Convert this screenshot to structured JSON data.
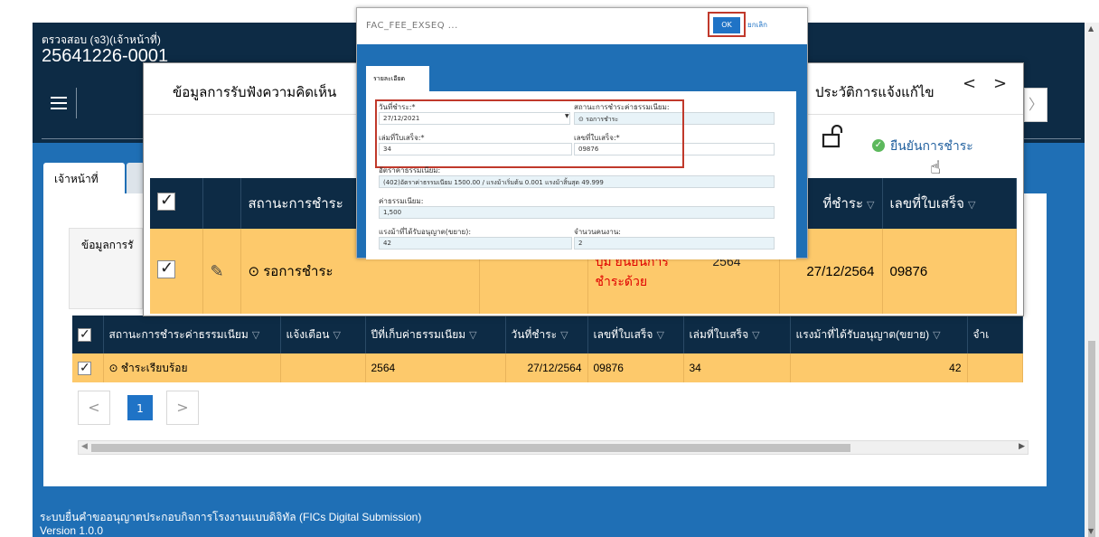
{
  "app": {
    "subtitle": "ตรวจสอบ (จ3)(เจ้าหน้าที่)",
    "title": "25641226-0001",
    "footer_line1": "ระบบยื่นคำขออนุญาตประกอบกิจการโรงงานแบบดิจิทัล (FICs Digital Submission)",
    "footer_line2": "Version 1.0.0"
  },
  "tabs": {
    "officer": "เจ้าหน้าที่"
  },
  "card": {
    "label": "ข้อมูลการรั"
  },
  "back_table": {
    "headers": [
      "สถานะการชำระค่าธรรมเนียม",
      "แจ้งเตือน",
      "ปีที่เก็บค่าธรรมเนียม",
      "วันที่ชำระ",
      "เลขที่ใบเสร็จ",
      "เล่มที่ใบเสร็จ",
      "แรงม้าที่ได้รับอนุญาต(ขยาย)",
      "จำเ"
    ],
    "row": {
      "status": "ชำระเรียบร้อย",
      "alert": "",
      "year": "2564",
      "pay_date": "27/12/2564",
      "receipt_no": "09876",
      "book_no": "34",
      "horsepower": "42",
      "extra": ""
    }
  },
  "pager": {
    "prev": "<",
    "current": "1",
    "next": ">"
  },
  "dialog": {
    "title": "ข้อมูลการรับฟังความคิดเห็น",
    "title_right": "ประวัติการแจ้งแก้ไข",
    "nav_prev": "<",
    "nav_next": ">",
    "confirm_label": "ยืนยันการชำระ",
    "headers": [
      "สถานะการชำระ",
      "ที่ชำระ",
      "เลขที่ใบเสร็จ"
    ],
    "row": {
      "status": "รอการชำระ",
      "annotation_line1": "ปุ่ม ยืนยันการ",
      "annotation_line2": "ชำระด้วย",
      "year": "2564",
      "pay_date": "27/12/2564",
      "receipt_no": "09876"
    }
  },
  "popup": {
    "title": "FAC_FEE_EXSEQ ...",
    "ok_label": "OK",
    "cancel_label": "ยกเลิก",
    "tab_label": "รายละเอียด",
    "fields": {
      "pay_date_label": "วันที่ชำระ:*",
      "pay_date_value": "27/12/2021",
      "status_label": "สถานะการชำระค่าธรรมเนียม:",
      "status_value": "รอการชำระ",
      "book_label": "เล่มที่ใบเสร็จ:*",
      "book_value": "34",
      "receipt_label": "เลขที่ใบเสร็จ:*",
      "receipt_value": "09876",
      "rate_label": "อัตราค่าธรรมเนียม:",
      "rate_value": "(402)อัตราค่าธรรมเนียม 1500.00 / แรงม้าเริ่มต้น 0.001 แรงม้าสิ้นสุด 49.999",
      "fee_label": "ค่าธรรมเนียม:",
      "fee_value": "1,500",
      "hp_label": "แรงม้าที่ได้รับอนุญาต(ขยาย):",
      "hp_value": "42",
      "workers_label": "จำนวนคนงาน:",
      "workers_value": "2"
    }
  },
  "colors": {
    "header_dark": "#0d2b45",
    "body_blue": "#1f6fb5",
    "row_orange": "#fdc96b",
    "accent_blue": "#1f73c6",
    "highlight_red": "#c0392b",
    "annotation_red": "#e00000"
  }
}
